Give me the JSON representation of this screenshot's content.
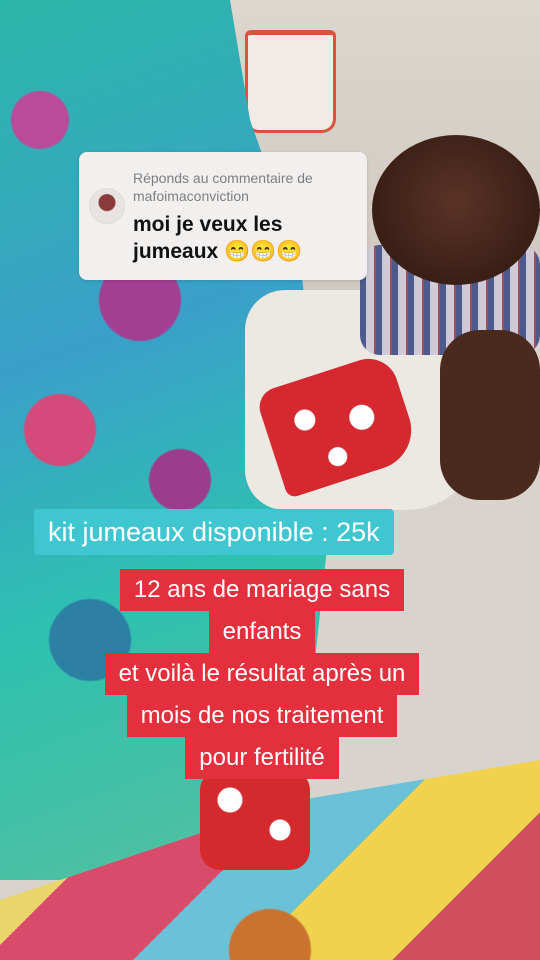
{
  "comment": {
    "reply_label": "Réponds au commentaire de mafoimaconviction",
    "text": "moi je veux les jumeaux 😁😁😁"
  },
  "overlay": {
    "banner": "kit jumeaux disponible : 25k",
    "lines": [
      "12 ans de mariage sans",
      "enfants",
      "et voilà le résultat après un",
      "mois de nos traitement",
      "pour fertilité"
    ]
  }
}
